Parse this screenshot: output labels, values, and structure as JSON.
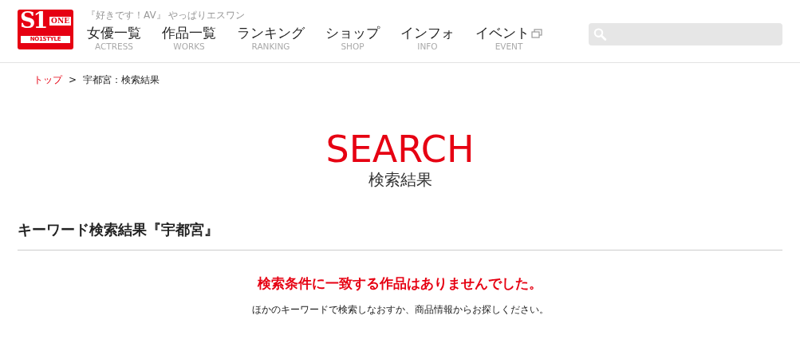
{
  "logo": {
    "mark": "S1",
    "word": "ONE",
    "tagline": "NO1STYLE"
  },
  "header": {
    "tagline": "『好きです！AV』 やっぱりエスワン"
  },
  "nav": [
    {
      "label": "女優一覧",
      "sub": "ACTRESS",
      "external": false
    },
    {
      "label": "作品一覧",
      "sub": "WORKS",
      "external": false
    },
    {
      "label": "ランキング",
      "sub": "RANKING",
      "external": false
    },
    {
      "label": "ショップ",
      "sub": "SHOP",
      "external": false
    },
    {
      "label": "インフォ",
      "sub": "INFO",
      "external": false
    },
    {
      "label": "イベント",
      "sub": "EVENT",
      "external": true
    }
  ],
  "breadcrumb": [
    {
      "label": "トップ",
      "link": true
    },
    {
      "label": "宇都宮：検索結果",
      "link": false
    }
  ],
  "breadcrumb_separator": ">",
  "page_title": {
    "title": "SEARCH",
    "subtitle": "検索結果"
  },
  "section_heading": "キーワード検索結果『宇都宮』",
  "message": {
    "title": "検索条件に一致する作品はありませんでした。",
    "body": "ほかのキーワードで検索しなおすか、商品情報からお探しください。"
  }
}
